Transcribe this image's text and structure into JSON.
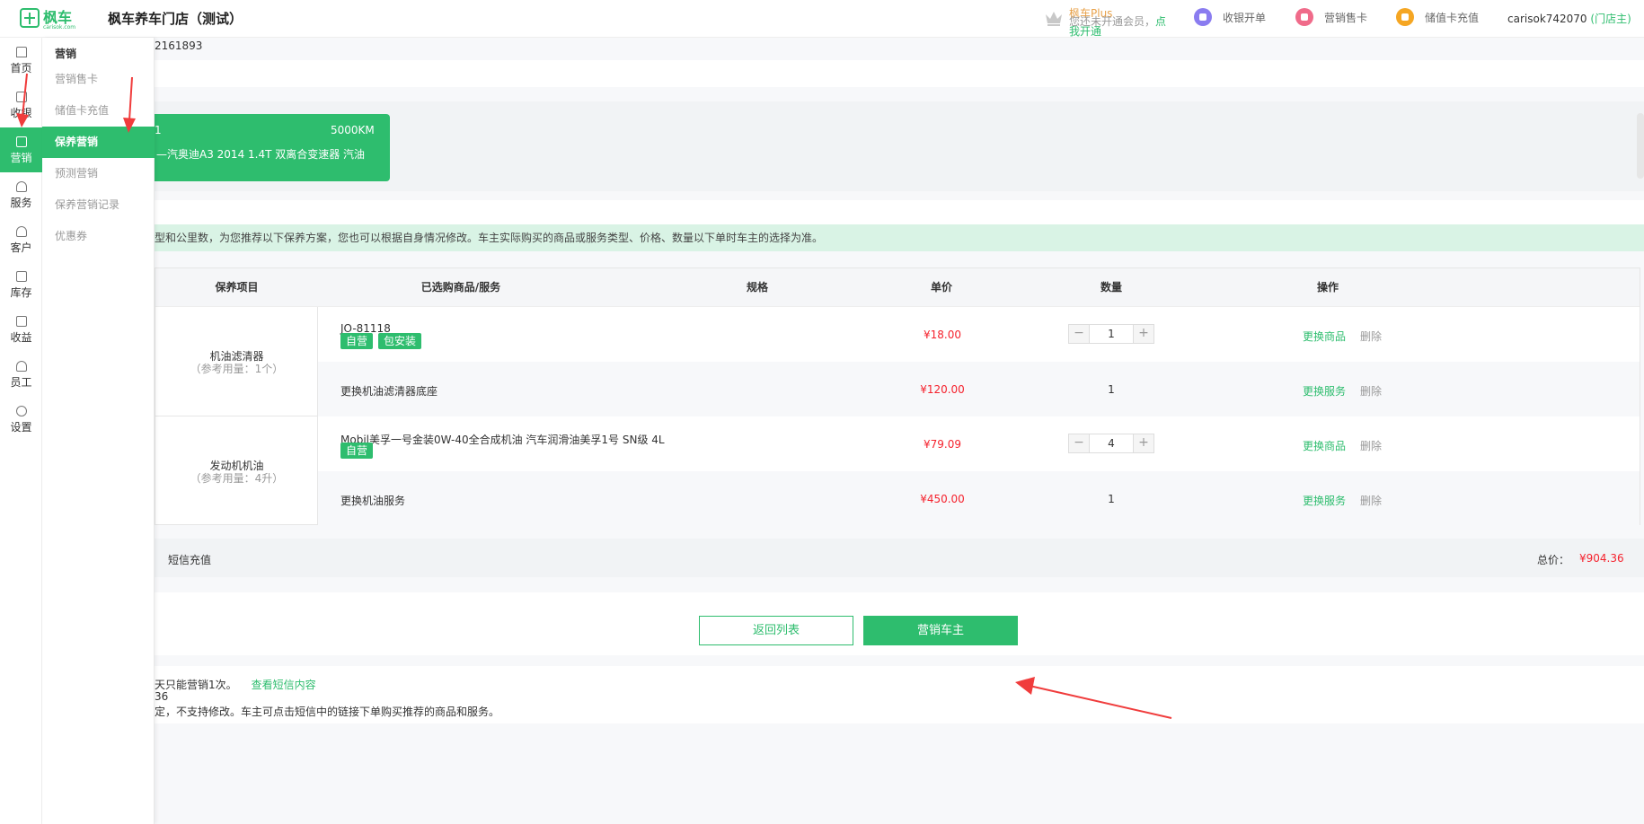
{
  "header": {
    "logo_text": "枫车",
    "logo_sub": "carisok.com",
    "shop_name": "枫车养车门店（测试）",
    "plus_title": "枫车Plus",
    "plus_desc": "您还未开通会员，",
    "plus_link": "点我开通",
    "nav": [
      {
        "label": "收银开单",
        "icon": "cashier-icon",
        "color": "#8a7cf0"
      },
      {
        "label": "营销售卡",
        "icon": "card-icon",
        "color": "#f06b8a"
      },
      {
        "label": "储值卡充值",
        "icon": "wallet-icon",
        "color": "#f5a623"
      }
    ],
    "user": "carisok742070",
    "user_role": "(门店主)"
  },
  "sidebar": {
    "items": [
      {
        "label": "首页",
        "icon": "home-icon"
      },
      {
        "label": "收银",
        "icon": "cashier-icon"
      },
      {
        "label": "营销",
        "icon": "marketing-icon"
      },
      {
        "label": "服务",
        "icon": "headset-icon"
      },
      {
        "label": "客户",
        "icon": "customer-icon"
      },
      {
        "label": "库存",
        "icon": "box-icon"
      },
      {
        "label": "收益",
        "icon": "chart-icon"
      },
      {
        "label": "员工",
        "icon": "staff-icon"
      },
      {
        "label": "设置",
        "icon": "settings-icon"
      }
    ],
    "active": "营销"
  },
  "submenu": {
    "title": "营销",
    "items": [
      "营销售卡",
      "储值卡充值",
      "保养营销",
      "预测营销",
      "保养营销记录",
      "优惠券"
    ],
    "active": "保养营销"
  },
  "main": {
    "order_no": "2161893",
    "car": {
      "plate": "1",
      "mileage": "5000KM",
      "model": "—汽奥迪A3 2014 1.4T 双离合变速器 汽油"
    },
    "notice": "型和公里数，为您推荐以下保养方案，您也可以根据自身情况修改。车主实际购买的商品或服务类型、价格、数量以下单时车主的选择为准。",
    "table": {
      "headers": [
        "保养项目",
        "已选购商品/服务",
        "规格",
        "单价",
        "数量",
        "操作"
      ],
      "groups": [
        {
          "name": "机油滤清器",
          "ref": "（参考用量：1个）",
          "rows": [
            {
              "product": "JO-81118",
              "tags": [
                "自营",
                "包安装"
              ],
              "price": "¥18.00",
              "qty": "1",
              "stepper": true,
              "change": "更换商品",
              "delete": "删除"
            },
            {
              "product": "更换机油滤清器底座",
              "tags": [],
              "price": "¥120.00",
              "qty": "1",
              "stepper": false,
              "change": "更换服务",
              "delete": "删除"
            }
          ]
        },
        {
          "name": "发动机机油",
          "ref": "（参考用量：4升）",
          "rows": [
            {
              "product": "Mobil美孚一号金装0W-40全合成机油 汽车润滑油美孚1号 SN级 4L",
              "tags": [
                "自营"
              ],
              "price": "¥79.09",
              "qty": "4",
              "stepper": true,
              "change": "更换商品",
              "delete": "删除"
            },
            {
              "product": "更换机油服务",
              "tags": [],
              "price": "¥450.00",
              "qty": "1",
              "stepper": false,
              "change": "更换服务",
              "delete": "删除"
            }
          ]
        }
      ]
    },
    "sms_label": "短信充值",
    "total_label": "总价：",
    "total_value": "¥904.36",
    "btn_back": "返回列表",
    "btn_market": "营销车主",
    "footer": {
      "line1": "天只能营销1次。",
      "line1_link": "查看短信内容",
      "line2": "36",
      "line3": "定，不支持修改。车主可点击短信中的链接下单购买推荐的商品和服务。"
    }
  },
  "colors": {
    "accent": "#2ebd6e",
    "price": "#f5222d",
    "annotation": "#f03c3c"
  }
}
